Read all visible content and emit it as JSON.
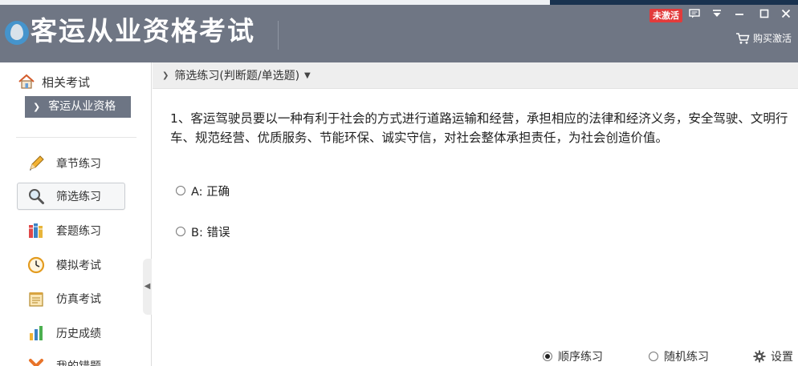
{
  "app": {
    "title": "客运从业资格考试",
    "status_badge": "未激活",
    "buy_label": "购买激活"
  },
  "window_controls": {
    "feedback": "▭",
    "menu": "▼",
    "minimize": "—",
    "maximize": "□",
    "close": "✕"
  },
  "sidebar": {
    "header": "相关考试",
    "selected_exam": "客运从业资格",
    "items": [
      {
        "label": "章节练习",
        "icon": "pencil-icon"
      },
      {
        "label": "筛选练习",
        "icon": "magnifier-icon"
      },
      {
        "label": "套题练习",
        "icon": "books-icon"
      },
      {
        "label": "模拟考试",
        "icon": "clock-icon"
      },
      {
        "label": "仿真考试",
        "icon": "notepad-icon"
      },
      {
        "label": "历史成绩",
        "icon": "bar-chart-icon"
      },
      {
        "label": "我的错题",
        "icon": "x-mark-icon"
      }
    ]
  },
  "breadcrumb": {
    "label": "筛选练习(判断题/单选题)"
  },
  "question": {
    "text": "1、客运驾驶员要以一种有利于社会的方式进行道路运输和经营，承担相应的法律和经济义务，安全驾驶、文明行车、规范经营、优质服务、节能环保、诚实守信，对社会整体承担责任，为社会创造价值。",
    "options": [
      {
        "label": "A: 正确"
      },
      {
        "label": "B: 错误"
      }
    ]
  },
  "footer": {
    "sequential": "顺序练习",
    "random": "随机练习",
    "settings": "设置"
  },
  "colors": {
    "header_bg": "#6f7684",
    "badge_red": "#e23b3b",
    "sidebar_selected_bg": "#6d7584"
  }
}
